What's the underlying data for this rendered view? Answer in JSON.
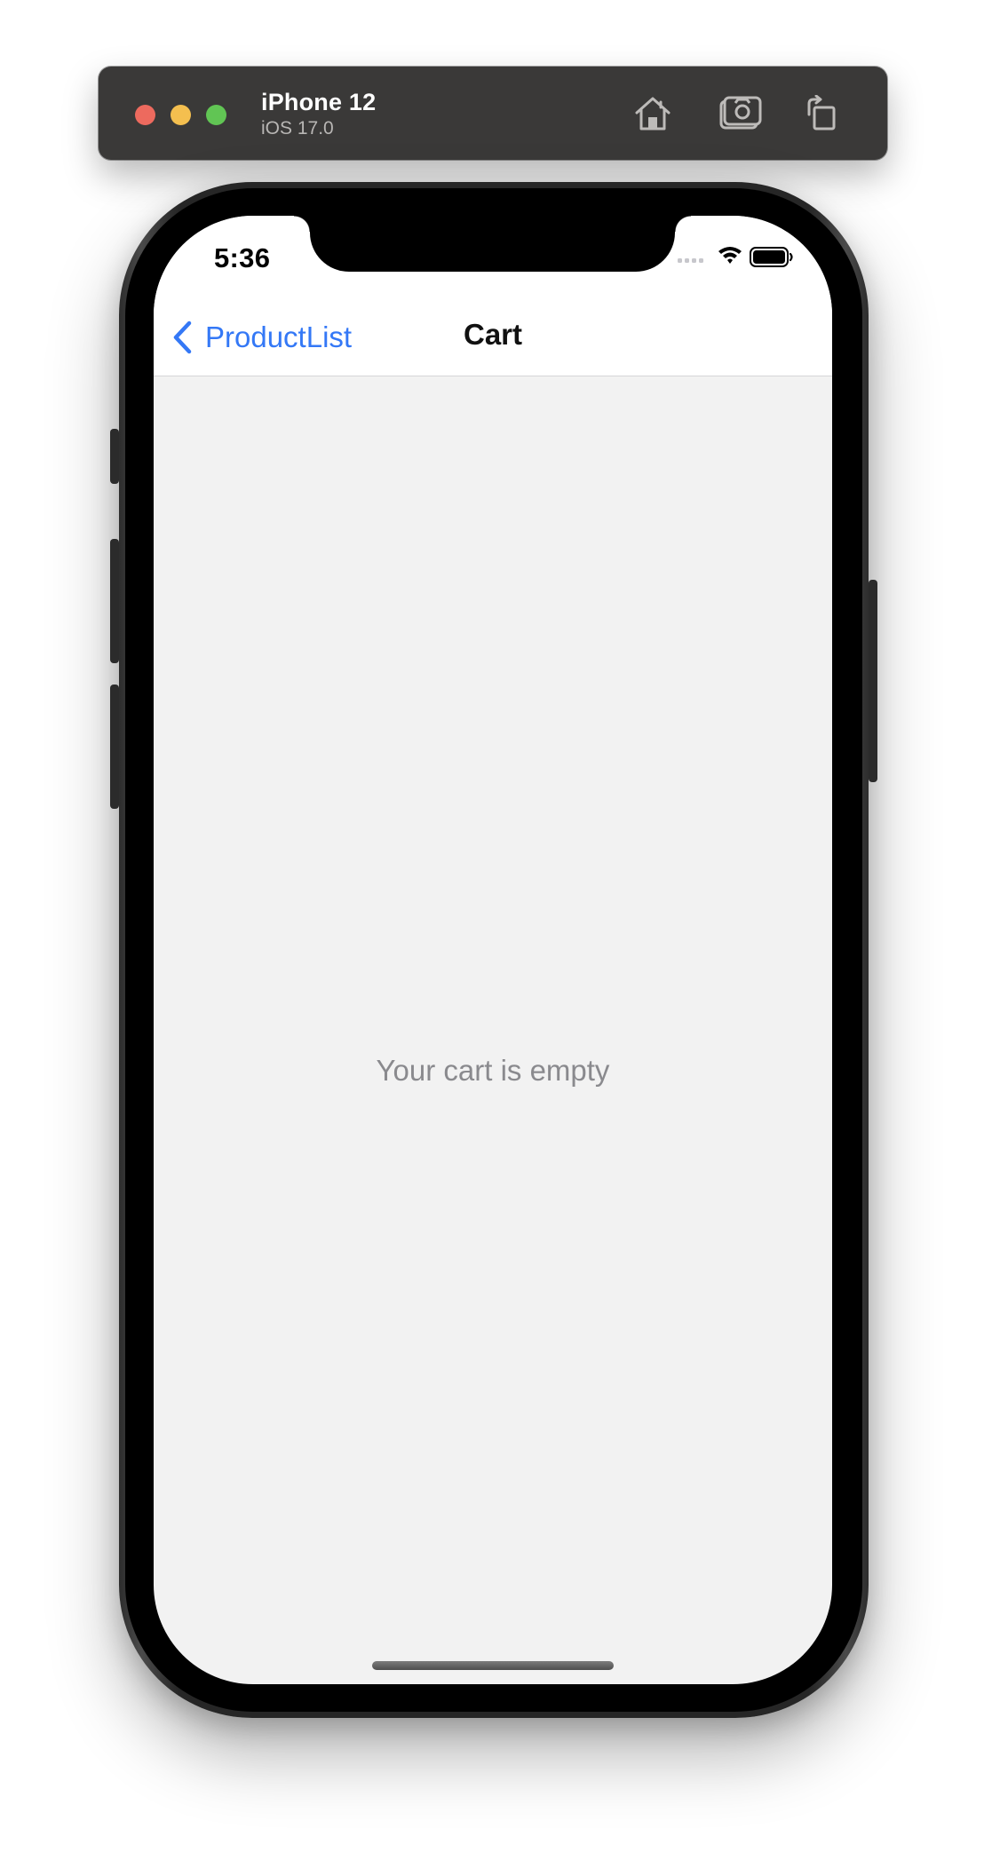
{
  "simulator": {
    "device_name": "iPhone 12",
    "os_version": "iOS 17.0",
    "toolbar_icons": [
      "home-icon",
      "screenshot-icon",
      "rotate-icon"
    ],
    "traffic_lights": {
      "close": "#ed6a5e",
      "minimize": "#f4bf4f",
      "zoom": "#61c554"
    }
  },
  "status_bar": {
    "time": "5:36",
    "icons": [
      "cellular-signal-icon",
      "wifi-icon",
      "battery-icon"
    ]
  },
  "nav_bar": {
    "back_label": "ProductList",
    "title": "Cart",
    "accent_color": "#3478f6"
  },
  "content": {
    "empty_message": "Your cart is empty",
    "background": "#f2f2f2"
  }
}
